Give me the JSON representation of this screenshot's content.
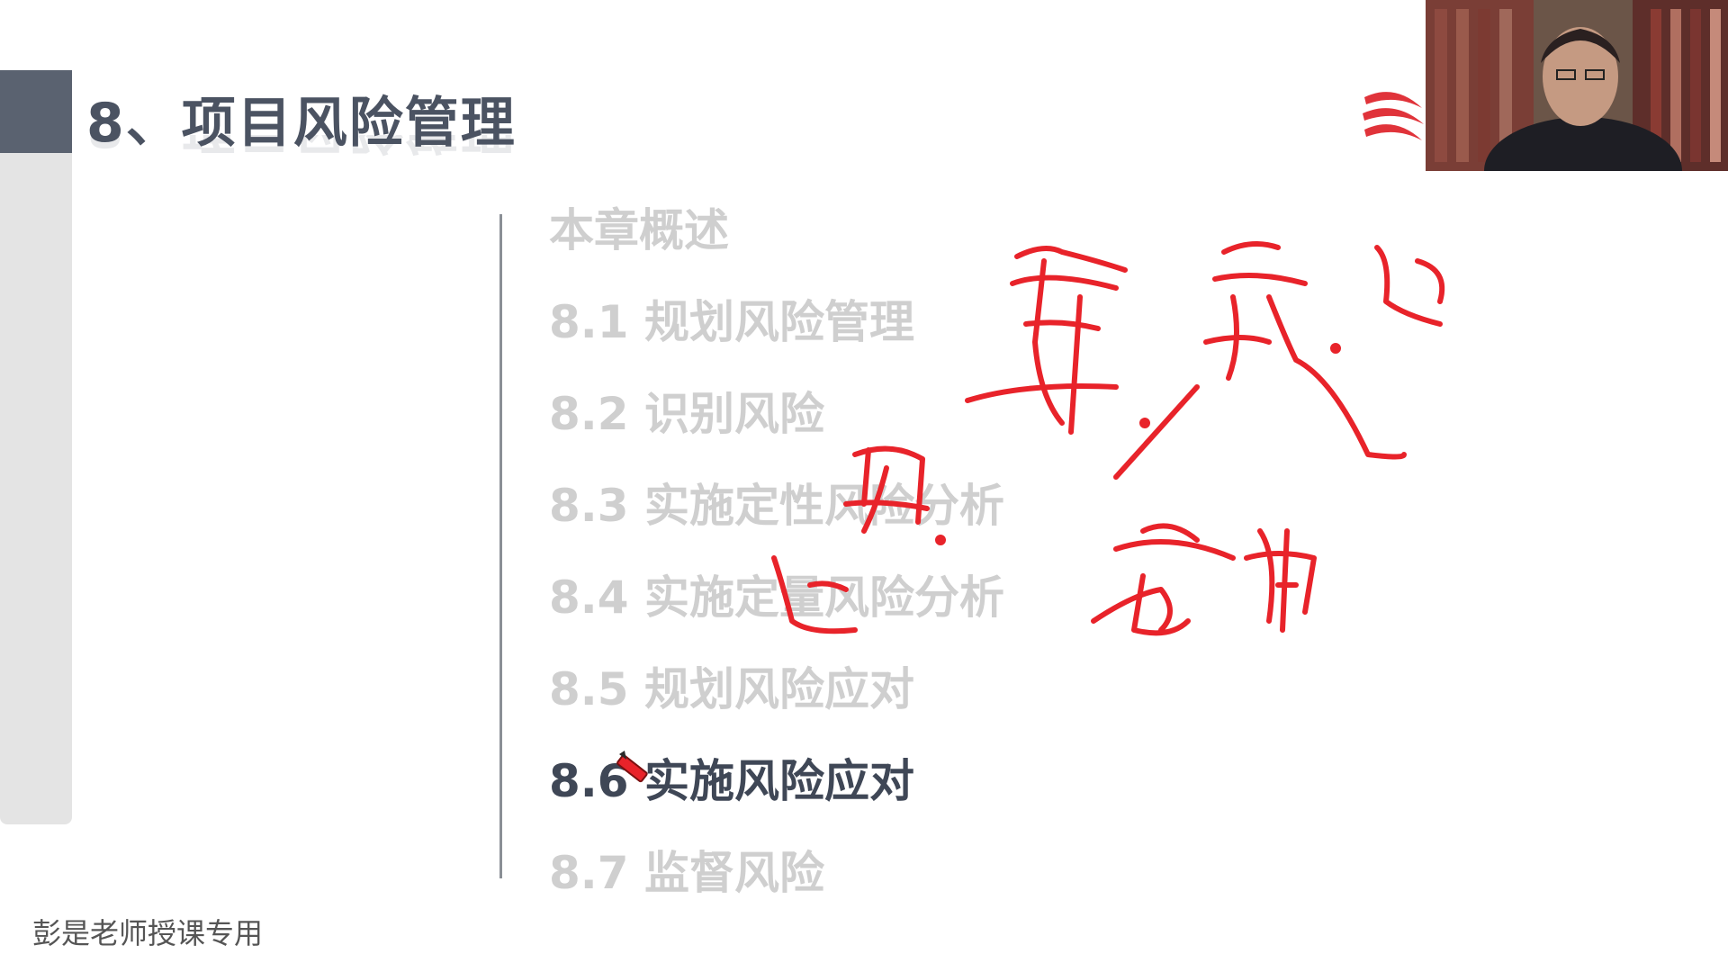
{
  "slide": {
    "title": "8、项目风险管理",
    "footer": "彭是老师授课专用",
    "toc": [
      {
        "label": "本章概述",
        "active": false
      },
      {
        "label": "8.1 规划风险管理",
        "active": false
      },
      {
        "label": "8.2 识别风险",
        "active": false
      },
      {
        "label": "8.3 实施定性风险分析",
        "active": false
      },
      {
        "label": "8.4 实施定量风险分析",
        "active": false
      },
      {
        "label": "8.5 规划风险应对",
        "active": false
      },
      {
        "label": "8.6 实施风险应对",
        "active": true
      },
      {
        "label": "8.7 监督风险",
        "active": false
      }
    ]
  },
  "icons": {
    "logo": "brand-logo-icon",
    "pen": "pen-tool-icon"
  },
  "colors": {
    "title_bar": "#5a6270",
    "title_text": "#4b5362",
    "inactive_item": "#cfcfcf",
    "active_item": "#3f4756",
    "annotation_ink": "#e8232a",
    "logo_red": "#e0333a"
  }
}
